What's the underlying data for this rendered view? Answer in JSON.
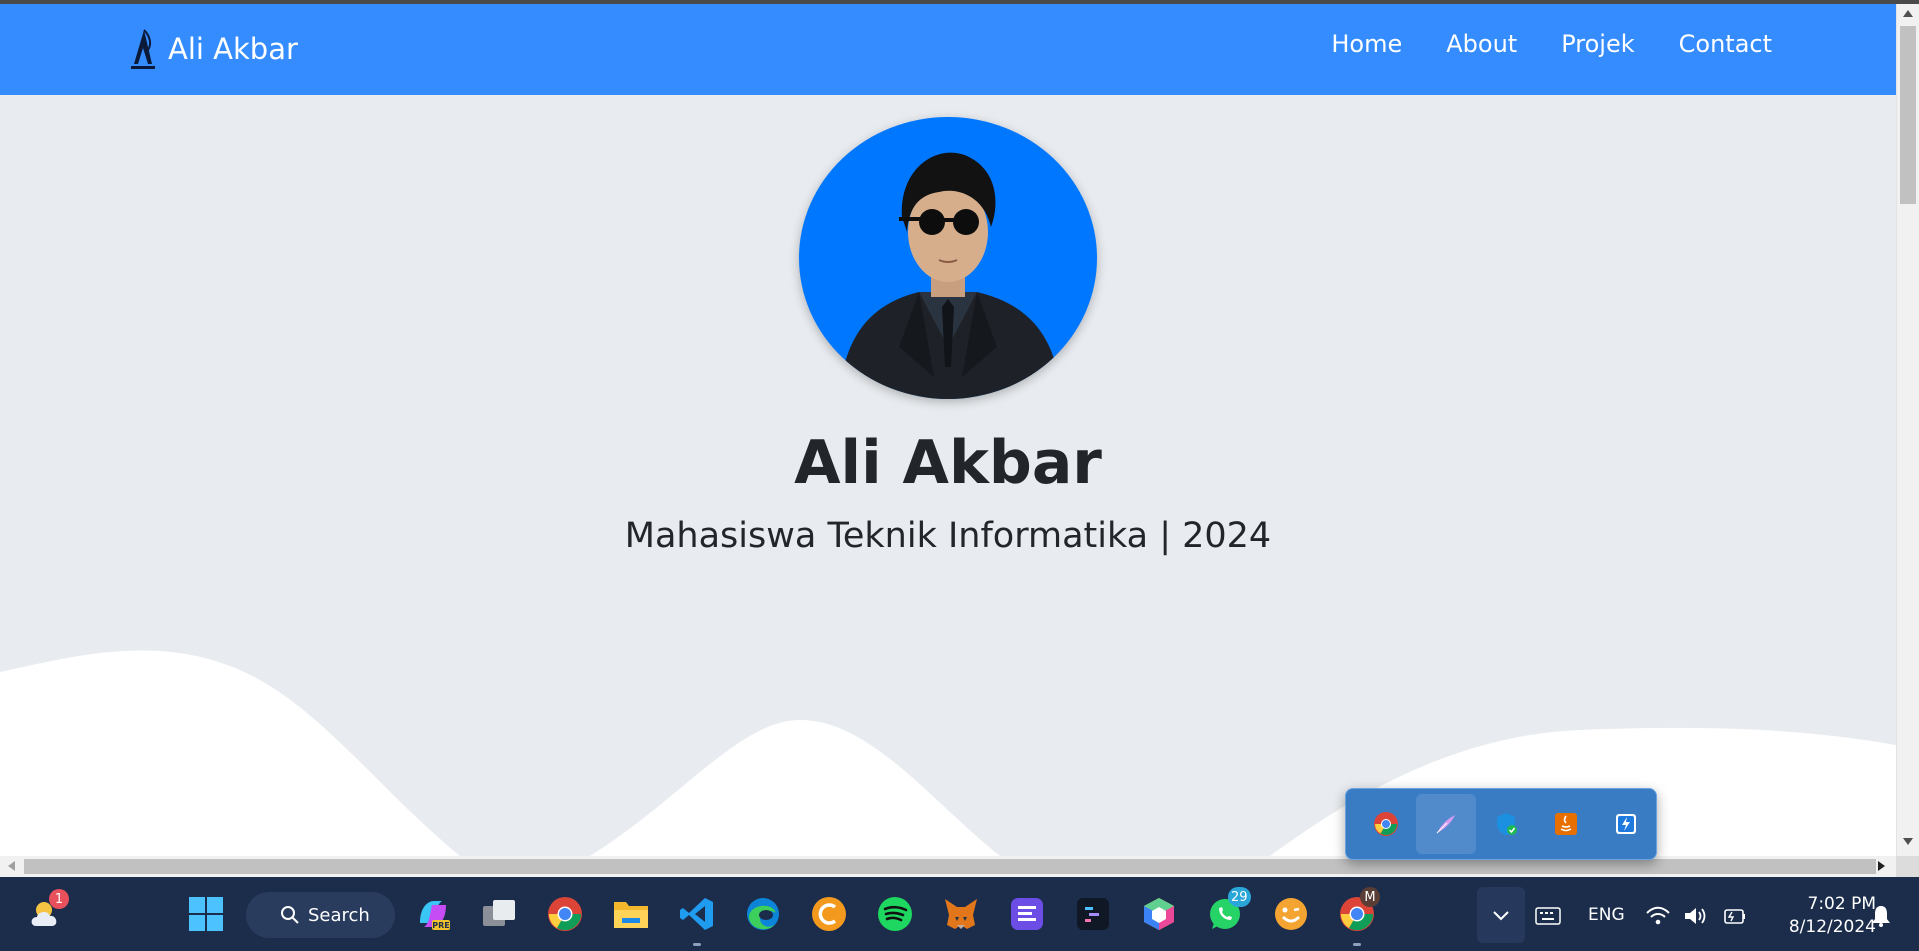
{
  "navbar": {
    "brand_name": "Ali Akbar",
    "links": [
      "Home",
      "About",
      "Projek",
      "Contact"
    ]
  },
  "hero": {
    "name": "Ali Akbar",
    "subtitle": "Mahasiswa Teknik Informatika | 2024"
  },
  "colors": {
    "navbar_bg": "#348cff",
    "page_bg": "#e8ebef",
    "avatar_bg": "#0077ff",
    "taskbar_bg": "#1c2d4c"
  },
  "tray_flyout": {
    "icons": [
      "chrome-icon",
      "feather-pen-icon",
      "security-shield-icon",
      "java-icon",
      "lightning-app-icon"
    ]
  },
  "taskbar": {
    "search_label": "Search",
    "weather_badge": "1",
    "whatsapp_badge": "29",
    "chrome_profile_badge": "M",
    "apps": [
      "weather-icon",
      "windows-start-icon",
      "copilot-icon",
      "task-view-icon",
      "chrome-icon",
      "file-explorer-icon",
      "vscode-icon",
      "edge-icon",
      "ccleaner-icon",
      "spotify-icon",
      "metamask-icon",
      "notes-app-icon",
      "terminal-app-icon",
      "box-app-icon",
      "whatsapp-icon",
      "emoji-app-icon",
      "chrome-profile-icon"
    ],
    "language": "ENG",
    "time": "7:02 PM",
    "date": "8/12/2024"
  }
}
